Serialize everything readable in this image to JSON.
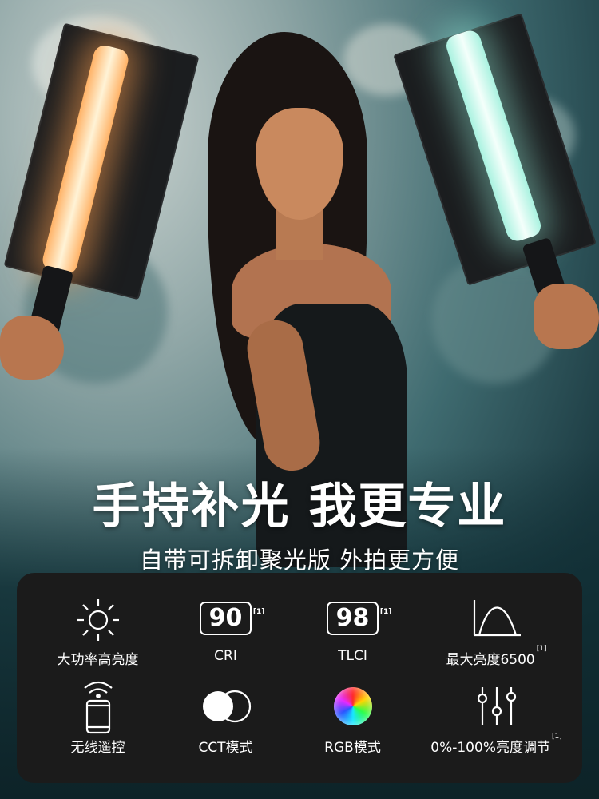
{
  "headline": {
    "title": "手持补光 我更专业",
    "subtitle": "自带可拆卸聚光版 外拍更方便"
  },
  "features": [
    {
      "icon": "sun-icon",
      "label": "大功率高亮度",
      "badge": "",
      "note": ""
    },
    {
      "icon": "badge",
      "label": "CRI",
      "badge": "90",
      "note": "[1]"
    },
    {
      "icon": "badge",
      "label": "TLCI",
      "badge": "98",
      "note": "[1]"
    },
    {
      "icon": "bell-curve-icon",
      "label": "最大亮度6500",
      "badge": "",
      "note": "[1]"
    },
    {
      "icon": "remote-phone-icon",
      "label": "无线遥控",
      "badge": "",
      "note": ""
    },
    {
      "icon": "cct-circles-icon",
      "label": "CCT模式",
      "badge": "",
      "note": ""
    },
    {
      "icon": "rgb-wheel-icon",
      "label": "RGB模式",
      "badge": "",
      "note": ""
    },
    {
      "icon": "sliders-icon",
      "label": "0%-100%亮度调节",
      "badge": "",
      "note": "[1]"
    }
  ],
  "colors": {
    "warm_light": "#ffd8a8",
    "cool_light": "#d8fff4",
    "panel": "#1b1b1b"
  }
}
